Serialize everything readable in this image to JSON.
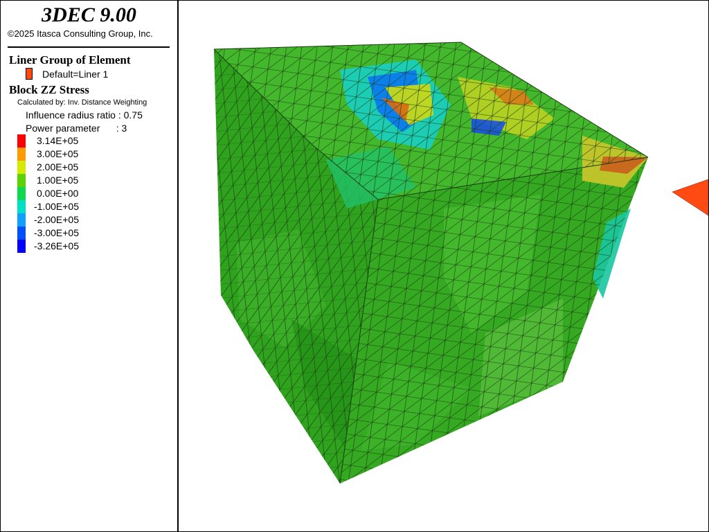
{
  "app": {
    "title": "3DEC 9.00",
    "copyright": "©2025 Itasca Consulting Group, Inc."
  },
  "legend": {
    "liner_heading": "Liner Group of Element",
    "liner_item": "Default=Liner 1",
    "liner_color": "#ff4a14",
    "block_heading": "Block  ZZ Stress",
    "calc_method": "Calculated by: Inv. Distance Weighting",
    "influence": "Influence radius ratio : 0.75",
    "power": "Power parameter      : 3",
    "colorbar": [
      {
        "label": "3.14E+05",
        "color": "#ff0000"
      },
      {
        "label": "3.00E+05",
        "color": "#ff9a00"
      },
      {
        "label": "2.00E+05",
        "color": "#d4ea00"
      },
      {
        "label": "1.00E+05",
        "color": "#5ad400"
      },
      {
        "label": "0.00E+00",
        "color": "#10d84c"
      },
      {
        "label": "-1.00E+05",
        "color": "#00e0c8"
      },
      {
        "label": "-2.00E+05",
        "color": "#10a0ff"
      },
      {
        "label": "-3.00E+05",
        "color": "#0050ff"
      },
      {
        "label": "-3.26E+05",
        "color": "#0000ff"
      }
    ]
  }
}
